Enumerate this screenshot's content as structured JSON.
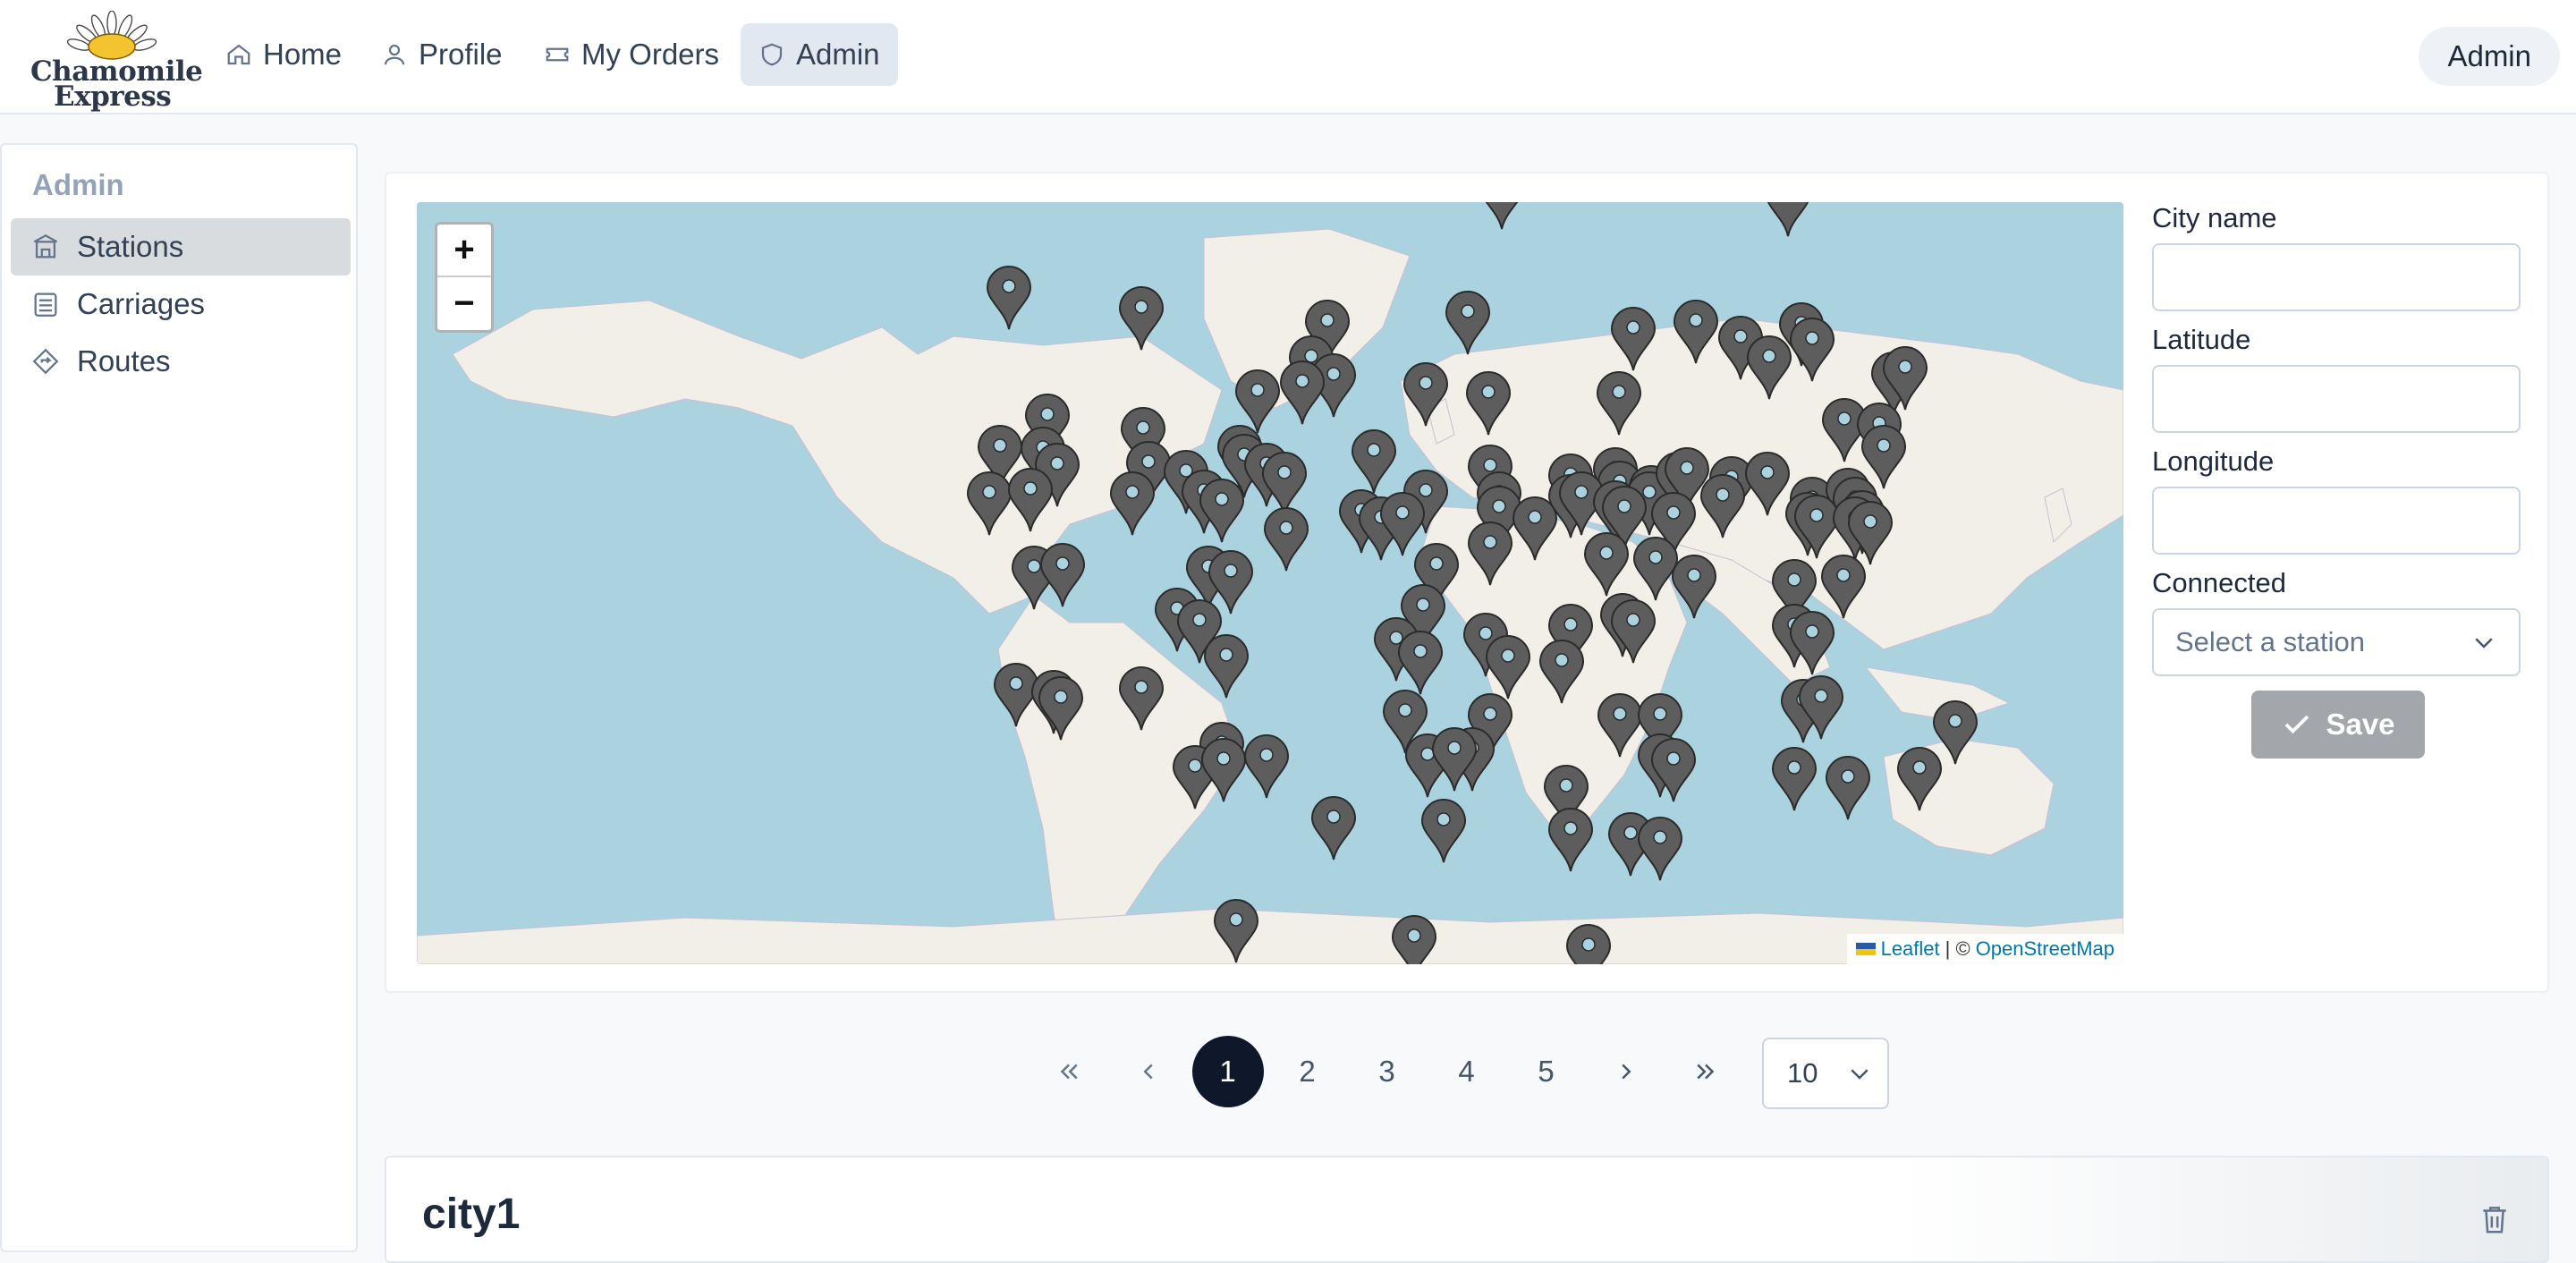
{
  "header": {
    "logo_line1": "Chamomile",
    "logo_line2": "Express",
    "nav": [
      {
        "label": "Home",
        "icon": "home-icon"
      },
      {
        "label": "Profile",
        "icon": "user-icon"
      },
      {
        "label": "My Orders",
        "icon": "ticket-icon"
      },
      {
        "label": "Admin",
        "icon": "shield-icon",
        "active": true
      }
    ],
    "user_label": "Admin"
  },
  "sidebar": {
    "title": "Admin",
    "items": [
      {
        "label": "Stations",
        "icon": "station-icon",
        "active": true
      },
      {
        "label": "Carriages",
        "icon": "carriage-icon"
      },
      {
        "label": "Routes",
        "icon": "route-icon"
      }
    ]
  },
  "map": {
    "zoom_in": "+",
    "zoom_out": "−",
    "attribution_leaflet": "Leaflet",
    "attribution_sep": "| ©",
    "attribution_osm": "OpenStreetMap",
    "colors": {
      "water": "#aad3df",
      "land": "#f2efe9",
      "marker": "#5d5d5d",
      "marker_dot": "#aad3df"
    }
  },
  "form": {
    "city_label": "City name",
    "city_value": "",
    "lat_label": "Latitude",
    "lat_value": "",
    "lng_label": "Longitude",
    "lng_value": "",
    "connected_label": "Connected",
    "connected_placeholder": "Select a station",
    "save_label": "Save"
  },
  "pagination": {
    "pages": [
      "1",
      "2",
      "3",
      "4",
      "5"
    ],
    "current": "1",
    "per_page": "10"
  },
  "list": {
    "first_city": "city1"
  }
}
